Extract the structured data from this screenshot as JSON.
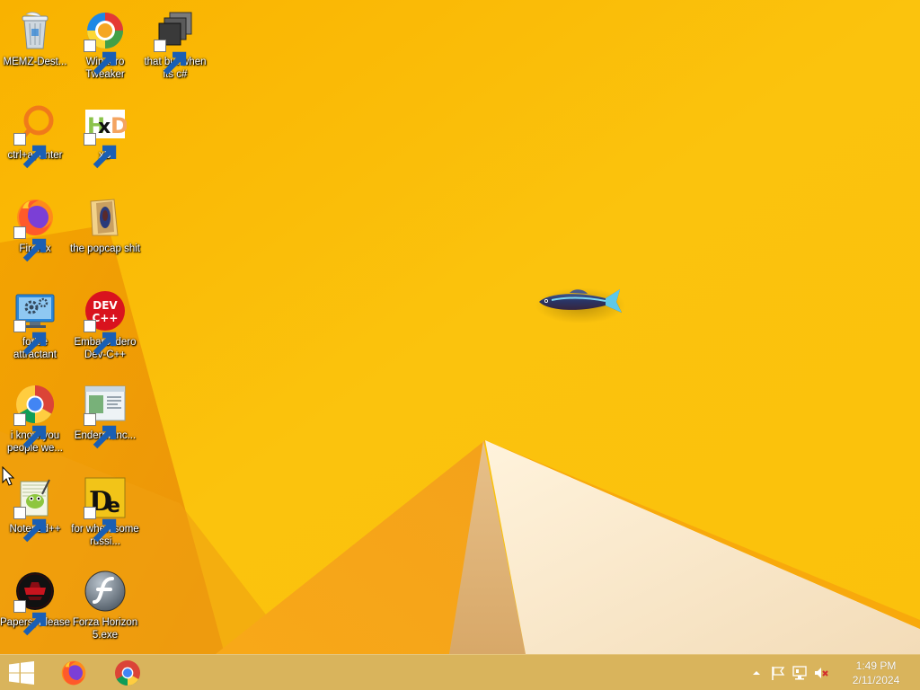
{
  "desktop": {
    "icons": [
      {
        "label": "MEMZ-Dest...",
        "icon": "recycle-bin-icon"
      },
      {
        "label": "Winaero Tweaker",
        "icon": "winaero-tweaker-icon"
      },
      {
        "label": "that but when its c#",
        "icon": "stacked-windows-icon"
      },
      {
        "label": "ctrl+a, enter",
        "icon": "magnifier-ring-icon"
      },
      {
        "label": "xD",
        "icon": "hxd-icon"
      },
      {
        "label": "Firefox",
        "icon": "firefox-icon"
      },
      {
        "label": "the popcap shit",
        "icon": "folder-icon"
      },
      {
        "label": "forkie attractant",
        "icon": "monitor-gear-icon"
      },
      {
        "label": "Embarcadero Dev-C++",
        "icon": "devcpp-icon"
      },
      {
        "label": "i know you people we...",
        "icon": "chrome-icon"
      },
      {
        "label": "Endermanc...",
        "icon": "window-app-icon"
      },
      {
        "label": "Notepad++",
        "icon": "notepadpp-icon"
      },
      {
        "label": "for when some russi...",
        "icon": "de-app-icon"
      },
      {
        "label": "Papers, Please",
        "icon": "papers-please-icon"
      },
      {
        "label": "Forza Horizon 5.exe",
        "icon": "flash-icon"
      }
    ]
  },
  "taskbar": {
    "start_icon": "windows-logo-icon",
    "pinned": [
      "firefox-icon",
      "chrome-icon"
    ],
    "tray_icons": [
      "chevron-up-icon",
      "flag-icon",
      "network-icon",
      "speaker-muted-icon"
    ],
    "clock_time": "1:49 PM",
    "clock_date": "2/11/2024"
  },
  "colors": {
    "wallpaper_base": "#f8b400",
    "wallpaper_light": "#fbc80e",
    "wallpaper_dark": "#e8900a",
    "taskbar": "#d9b45c"
  }
}
